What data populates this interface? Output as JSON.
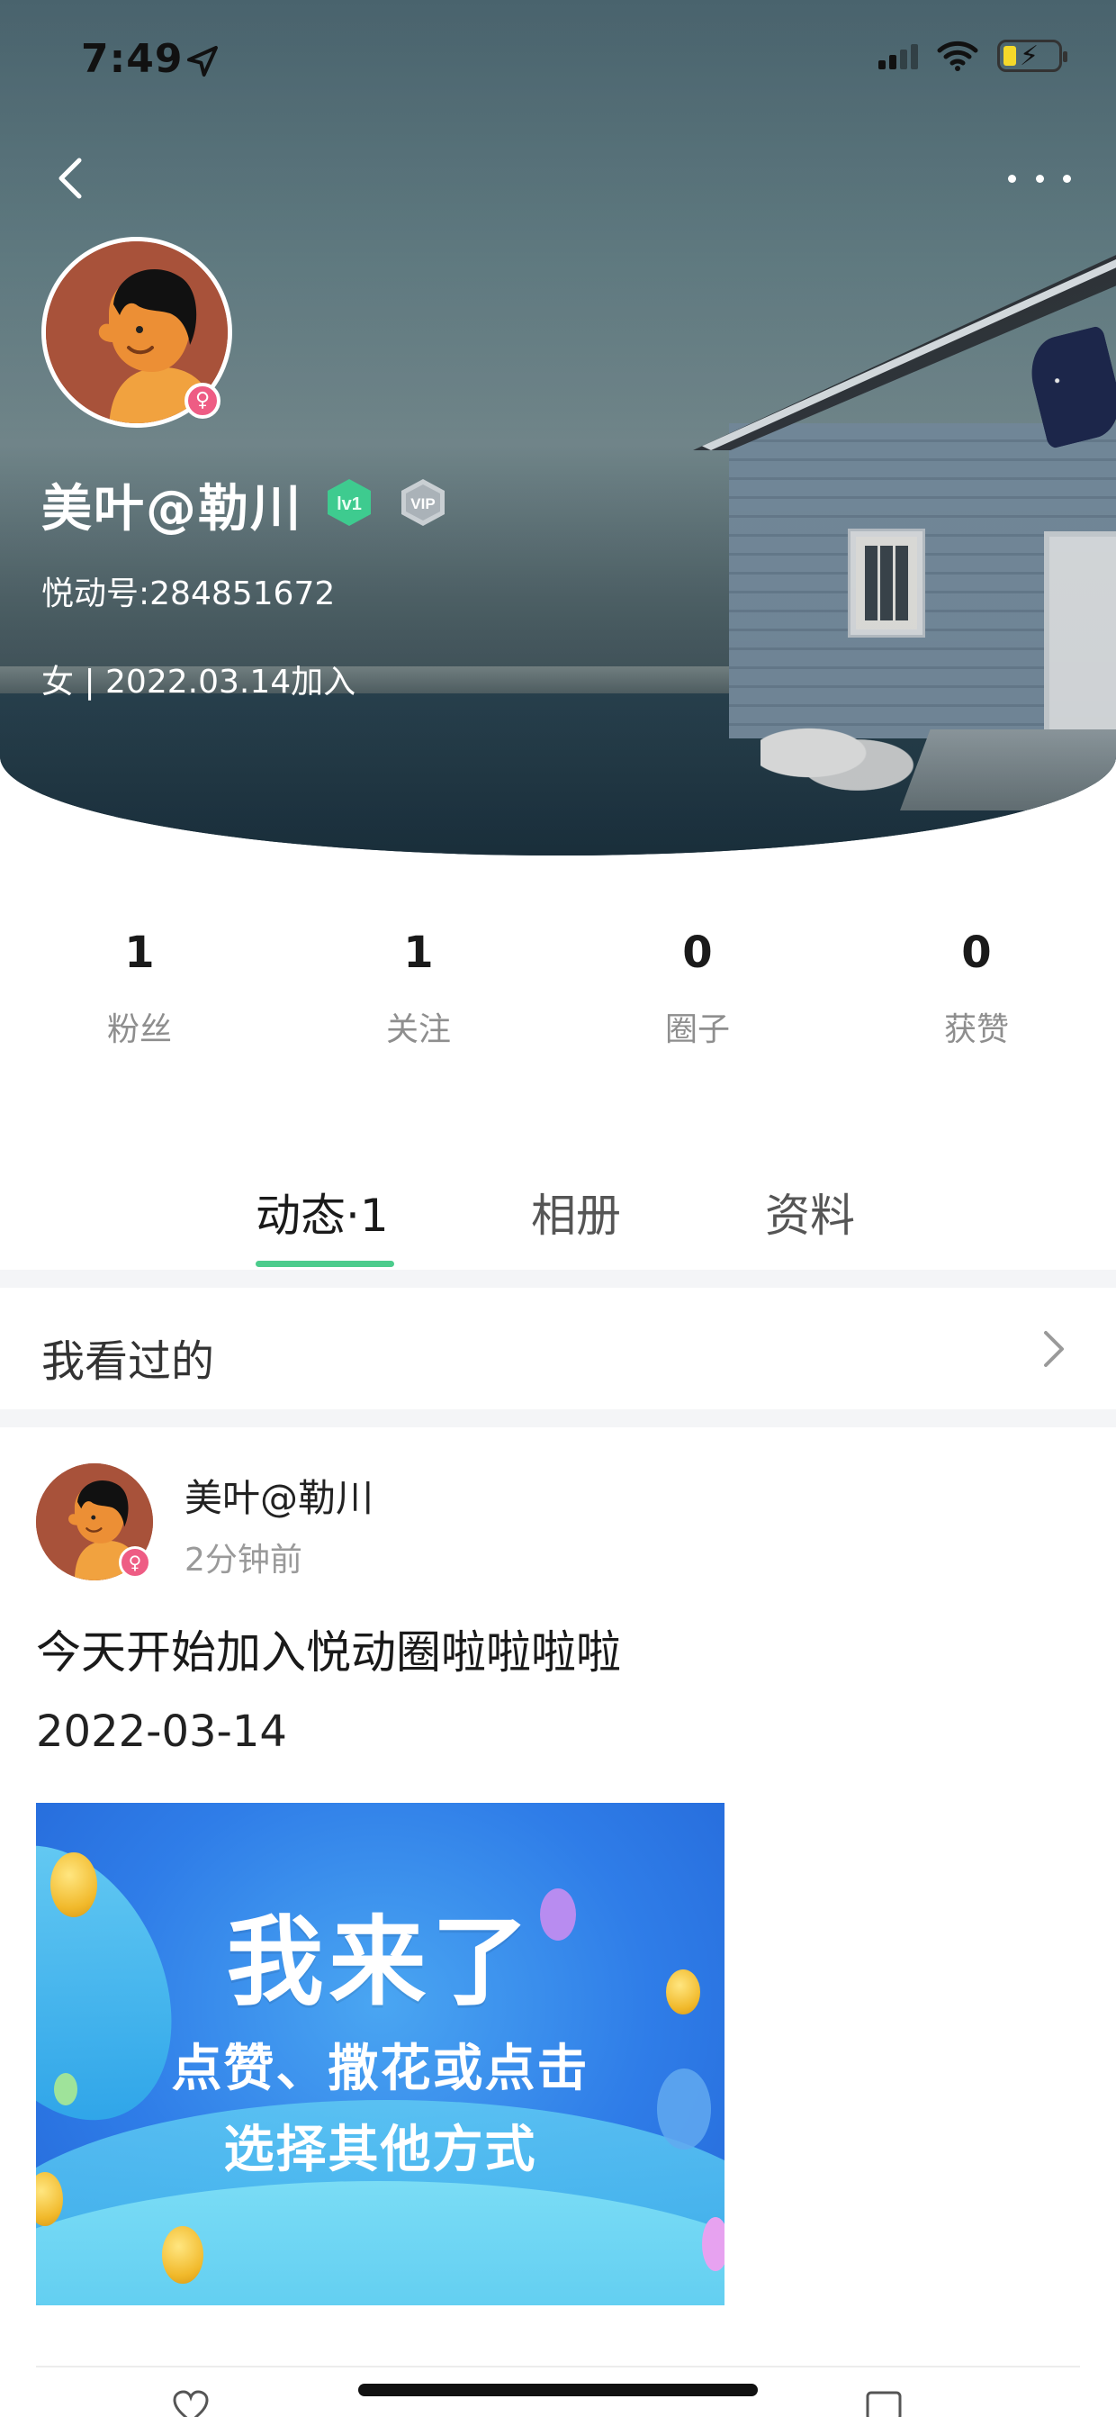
{
  "status_bar": {
    "time": "7:49",
    "colors": {
      "battery_fill": "#f5d92a"
    }
  },
  "nav": {
    "back_icon": "chevron-left-icon",
    "more_icon": "more-dots-icon"
  },
  "profile": {
    "name": "美叶@勒川",
    "level_badge": "lv1",
    "vip_badge": "VIP",
    "id_line": "悦动号:284851672",
    "meta_line": "女 | 2022.03.14加入",
    "gender_icon": "female-icon"
  },
  "stats": [
    {
      "value": "1",
      "label": "粉丝"
    },
    {
      "value": "1",
      "label": "关注"
    },
    {
      "value": "0",
      "label": "圈子"
    },
    {
      "value": "0",
      "label": "获赞"
    }
  ],
  "tabs": [
    {
      "label": "动态·1",
      "active": true
    },
    {
      "label": "相册",
      "active": false
    },
    {
      "label": "资料",
      "active": false
    }
  ],
  "accent_color": "#4ccc8c",
  "viewed": {
    "label": "我看过的"
  },
  "post": {
    "author": "美叶@勒川",
    "time": "2分钟前",
    "text": "今天开始加入悦动圈啦啦啦啦",
    "date": "2022-03-14",
    "image": {
      "title": "我来了",
      "line1": "点赞、撒花或点击",
      "line2": "选择其他方式"
    }
  }
}
